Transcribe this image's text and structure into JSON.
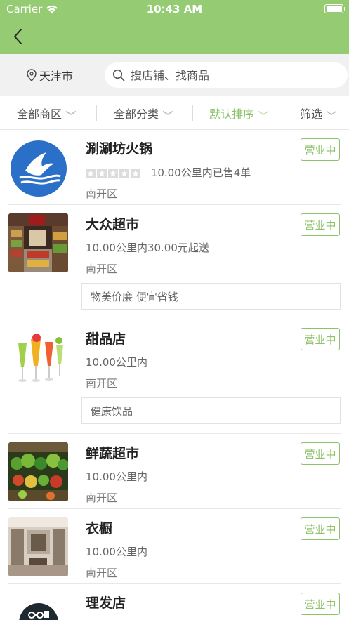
{
  "status_bar": {
    "carrier": "Carrier",
    "time": "10:43 AM"
  },
  "location": {
    "city": "天津市"
  },
  "search": {
    "placeholder": "搜店铺、找商品"
  },
  "filters": [
    {
      "label": "全部商区",
      "active": false
    },
    {
      "label": "全部分类",
      "active": false
    },
    {
      "label": "默认排序",
      "active": true
    },
    {
      "label": "筛选",
      "active": false
    }
  ],
  "colors": {
    "accent": "#95cb73",
    "accent_text": "#8cc26a"
  },
  "stores": [
    {
      "name": "涮涮坊火锅",
      "meta": "10.00公里内已售4单",
      "area": "南开区",
      "status": "营业中",
      "rating_stars": 0,
      "image": "swallow-logo"
    },
    {
      "name": "大众超市",
      "meta": "10.00公里内30.00元起送",
      "area": "南开区",
      "status": "营业中",
      "notice": "物美价廉 便宜省钱",
      "image": "supermarket-photo"
    },
    {
      "name": "甜品店",
      "meta": "10.00公里内",
      "area": "南开区",
      "status": "营业中",
      "notice": "健康饮品",
      "image": "drinks-photo"
    },
    {
      "name": "鲜蔬超市",
      "meta": "10.00公里内",
      "area": "南开区",
      "status": "营业中",
      "image": "vegetables-photo"
    },
    {
      "name": "衣橱",
      "meta": "10.00公里内",
      "area": "南开区",
      "status": "营业中",
      "image": "wardrobe-photo"
    },
    {
      "name": "理发店",
      "status": "营业中",
      "image": "scissors-logo"
    }
  ]
}
